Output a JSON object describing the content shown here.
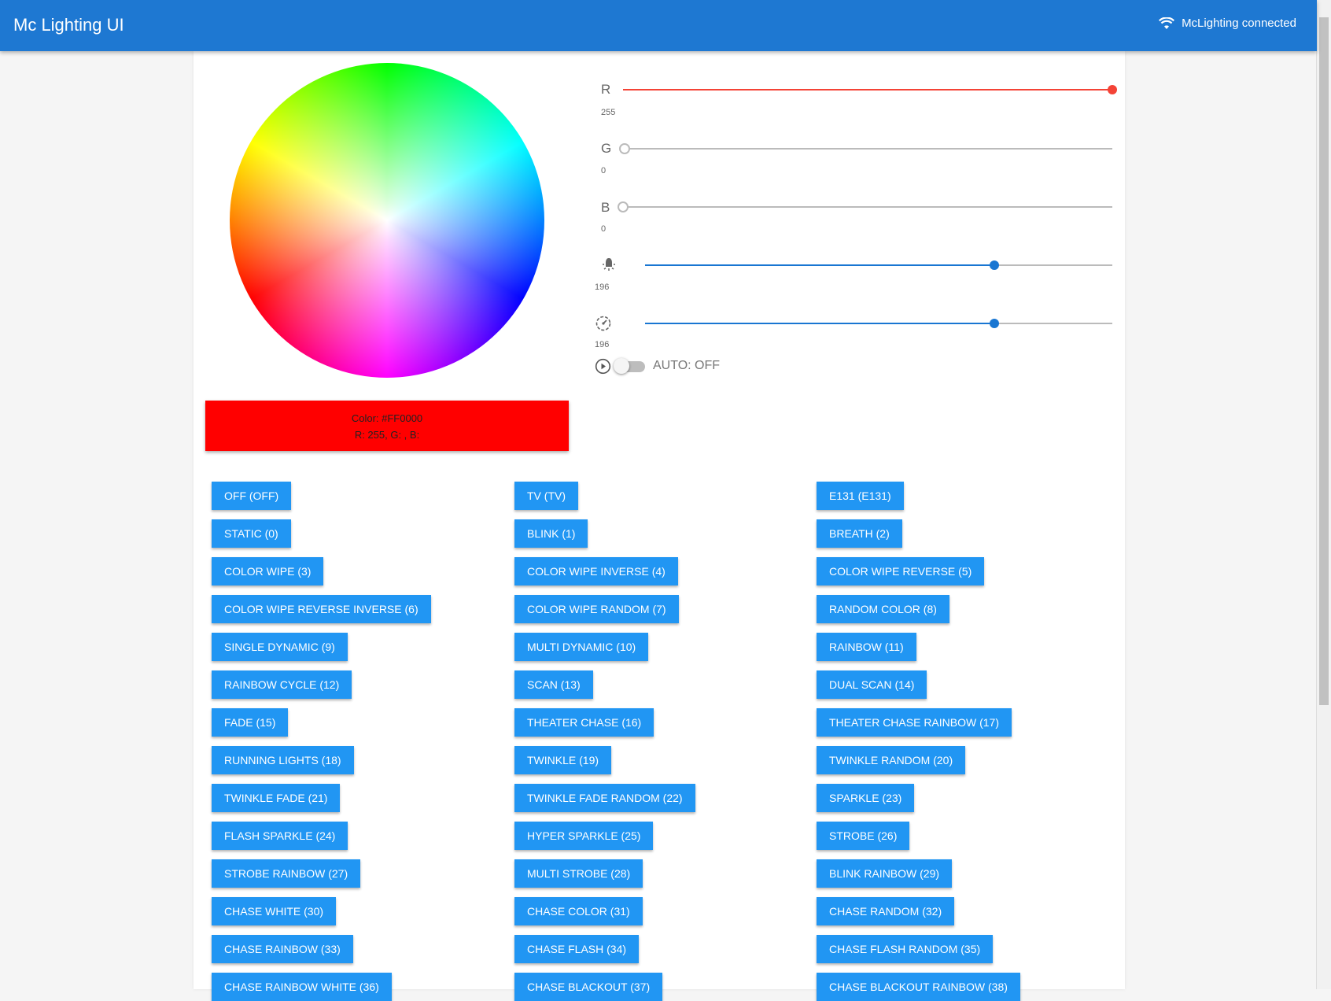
{
  "app": {
    "title": "Mc Lighting UI",
    "status": "McLighting connected"
  },
  "color": {
    "hex_line": "Color: #FF0000",
    "rgb_line": "R: 255, G: , B: ",
    "hex": "#ff0000"
  },
  "sliders": {
    "r": {
      "label": "R",
      "value": "255",
      "max": 255,
      "color": "#f44336"
    },
    "g": {
      "label": "G",
      "value": "0",
      "max": 255
    },
    "b": {
      "label": "B",
      "value": "0",
      "max": 255
    },
    "brightness": {
      "icon": "brightness-icon",
      "value": "196",
      "max": 255
    },
    "speed": {
      "icon": "speed-icon",
      "value": "196",
      "max": 255
    }
  },
  "auto": {
    "label": "AUTO: OFF",
    "on": false
  },
  "accent": "#1976d2",
  "modes": [
    [
      "OFF (OFF)",
      "TV (TV)",
      "E131 (E131)"
    ],
    [
      "STATIC (0)",
      "BLINK (1)",
      "BREATH (2)"
    ],
    [
      "COLOR WIPE (3)",
      "COLOR WIPE INVERSE (4)",
      "COLOR WIPE REVERSE (5)"
    ],
    [
      "COLOR WIPE REVERSE INVERSE (6)",
      "COLOR WIPE RANDOM (7)",
      "RANDOM COLOR (8)"
    ],
    [
      "SINGLE DYNAMIC (9)",
      "MULTI DYNAMIC (10)",
      "RAINBOW (11)"
    ],
    [
      "RAINBOW CYCLE (12)",
      "SCAN (13)",
      "DUAL SCAN (14)"
    ],
    [
      "FADE (15)",
      "THEATER CHASE (16)",
      "THEATER CHASE RAINBOW (17)"
    ],
    [
      "RUNNING LIGHTS (18)",
      "TWINKLE (19)",
      "TWINKLE RANDOM (20)"
    ],
    [
      "TWINKLE FADE (21)",
      "TWINKLE FADE RANDOM (22)",
      "SPARKLE (23)"
    ],
    [
      "FLASH SPARKLE (24)",
      "HYPER SPARKLE (25)",
      "STROBE (26)"
    ],
    [
      "STROBE RAINBOW (27)",
      "MULTI STROBE (28)",
      "BLINK RAINBOW (29)"
    ],
    [
      "CHASE WHITE (30)",
      "CHASE COLOR (31)",
      "CHASE RANDOM (32)"
    ],
    [
      "CHASE RAINBOW (33)",
      "CHASE FLASH (34)",
      "CHASE FLASH RANDOM (35)"
    ],
    [
      "CHASE RAINBOW WHITE (36)",
      "CHASE BLACKOUT (37)",
      "CHASE BLACKOUT RAINBOW (38)"
    ]
  ]
}
